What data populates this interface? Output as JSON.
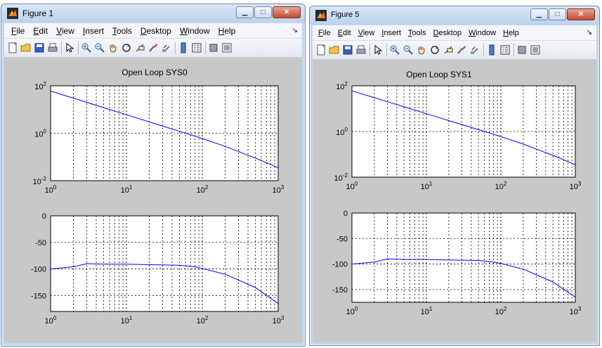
{
  "windows": [
    {
      "title": "Figure 1",
      "menu": [
        "File",
        "Edit",
        "View",
        "Insert",
        "Tools",
        "Desktop",
        "Window",
        "Help"
      ],
      "plot_title": "Open Loop SYS0"
    },
    {
      "title": "Figure 5",
      "menu": [
        "File",
        "Edit",
        "View",
        "Insert",
        "Tools",
        "Desktop",
        "Window",
        "Help"
      ],
      "plot_title": "Open Loop SYS1"
    }
  ],
  "toolbar_icons": [
    "new-figure-icon",
    "open-file-icon",
    "save-icon",
    "print-icon",
    "pointer-arrow-icon",
    "zoom-in-icon",
    "zoom-out-icon",
    "pan-hand-icon",
    "rotate-3d-icon",
    "data-cursor-icon",
    "brush-icon",
    "link-plot-icon",
    "colorbar-icon",
    "legend-icon",
    "hide-plot-tools-icon",
    "show-plot-tools-icon"
  ],
  "colors": {
    "line": "#0000ff",
    "plot_bg": "#ffffff",
    "figure_bg": "#c8c8c8"
  },
  "chart_data": [
    {
      "type": "line",
      "title": "Open Loop SYS0",
      "subplots": [
        {
          "x_scale": "log",
          "y_scale": "log",
          "xlim": [
            1,
            1000
          ],
          "ylim": [
            0.01,
            100
          ],
          "x_ticks": [
            "10^0",
            "10^1",
            "10^2",
            "10^3"
          ],
          "y_ticks": [
            "10^-2",
            "10^0",
            "10^2"
          ],
          "grid": true,
          "series": [
            {
              "x": [
                1,
                2,
                3,
                5,
                10,
                20,
                50,
                100,
                200,
                500,
                1000
              ],
              "y": [
                60,
                30,
                20,
                12,
                6,
                3,
                1.2,
                0.6,
                0.28,
                0.09,
                0.035
              ]
            }
          ]
        },
        {
          "x_scale": "log",
          "y_scale": "linear",
          "xlim": [
            1,
            1000
          ],
          "ylim": [
            -180,
            0
          ],
          "x_ticks": [
            "10^0",
            "10^1",
            "10^2",
            "10^3"
          ],
          "y_ticks": [
            "0",
            "-50",
            "-100",
            "-150"
          ],
          "grid": true,
          "series": [
            {
              "x": [
                1,
                2,
                3,
                5,
                10,
                20,
                50,
                80,
                100,
                200,
                500,
                1000
              ],
              "y": [
                -100,
                -96,
                -90,
                -91,
                -91,
                -92,
                -93,
                -96,
                -99,
                -110,
                -135,
                -165
              ]
            }
          ]
        }
      ]
    },
    {
      "type": "line",
      "title": "Open Loop SYS1",
      "subplots": [
        {
          "x_scale": "log",
          "y_scale": "log",
          "xlim": [
            1,
            1000
          ],
          "ylim": [
            0.01,
            100
          ],
          "x_ticks": [
            "10^0",
            "10^1",
            "10^2",
            "10^3"
          ],
          "y_ticks": [
            "10^-2",
            "10^0",
            "10^2"
          ],
          "grid": true,
          "series": [
            {
              "x": [
                1,
                2,
                3,
                5,
                10,
                20,
                50,
                100,
                200,
                500,
                1000
              ],
              "y": [
                60,
                30,
                20,
                12,
                6,
                3,
                1.2,
                0.6,
                0.28,
                0.09,
                0.035
              ]
            }
          ]
        },
        {
          "x_scale": "log",
          "y_scale": "linear",
          "xlim": [
            1,
            1000
          ],
          "ylim": [
            -175,
            0
          ],
          "x_ticks": [
            "10^0",
            "10^1",
            "10^2",
            "10^3"
          ],
          "y_ticks": [
            "0",
            "-50",
            "-100",
            "-150"
          ],
          "grid": true,
          "series": [
            {
              "x": [
                1,
                2,
                3,
                5,
                10,
                20,
                50,
                80,
                100,
                200,
                500,
                1000
              ],
              "y": [
                -100,
                -96,
                -90,
                -91,
                -91,
                -92,
                -93,
                -96,
                -99,
                -110,
                -135,
                -165
              ]
            }
          ]
        }
      ]
    }
  ]
}
